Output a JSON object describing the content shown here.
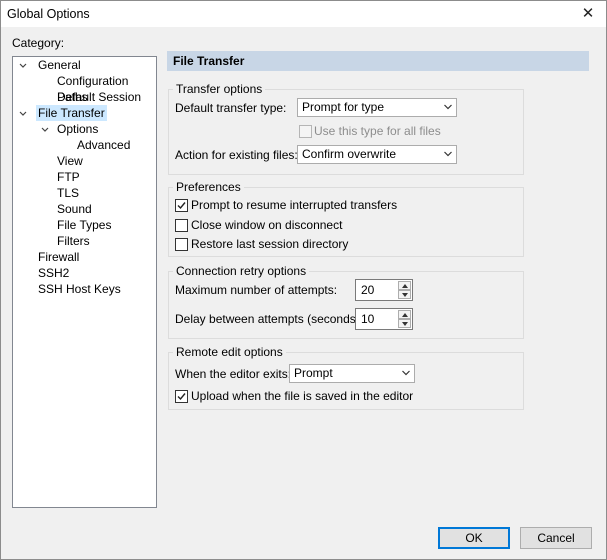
{
  "window": {
    "title": "Global Options"
  },
  "category_label": "Category:",
  "tree": {
    "general": "General",
    "configuration_paths": "Configuration Paths",
    "default_session": "Default Session",
    "file_transfer": "File Transfer",
    "options": "Options",
    "advanced": "Advanced",
    "view": "View",
    "ftp": "FTP",
    "tls": "TLS",
    "sound": "Sound",
    "file_types": "File Types",
    "filters": "Filters",
    "firewall": "Firewall",
    "ssh2": "SSH2",
    "ssh_host_keys": "SSH Host Keys"
  },
  "panel": {
    "title": "File Transfer",
    "transfer_options": {
      "title": "Transfer options",
      "default_type_label": "Default transfer type:",
      "default_type_value": "Prompt for type",
      "use_for_all_label": "Use this type for all files",
      "existing_files_label": "Action for existing files:",
      "existing_files_value": "Confirm overwrite"
    },
    "preferences": {
      "title": "Preferences",
      "resume_label": "Prompt to resume interrupted transfers",
      "close_window_label": "Close window on disconnect",
      "restore_dir_label": "Restore last session directory"
    },
    "retry": {
      "title": "Connection retry options",
      "max_attempts_label": "Maximum number of attempts:",
      "max_attempts_value": "20",
      "delay_label": "Delay between attempts (seconds):",
      "delay_value": "10"
    },
    "remote_edit": {
      "title": "Remote edit options",
      "editor_exits_label": "When the editor exits:",
      "editor_exits_value": "Prompt",
      "upload_label": "Upload when the file is saved in the editor"
    }
  },
  "buttons": {
    "ok": "OK",
    "cancel": "Cancel"
  },
  "state": {
    "resume_checked": true,
    "close_window_checked": false,
    "restore_dir_checked": false,
    "use_for_all_checked": false,
    "upload_checked": true
  },
  "colors": {
    "header_bg": "#c8d6e6",
    "selection_bg": "#cce8ff",
    "default_button_border": "#0078d7"
  }
}
